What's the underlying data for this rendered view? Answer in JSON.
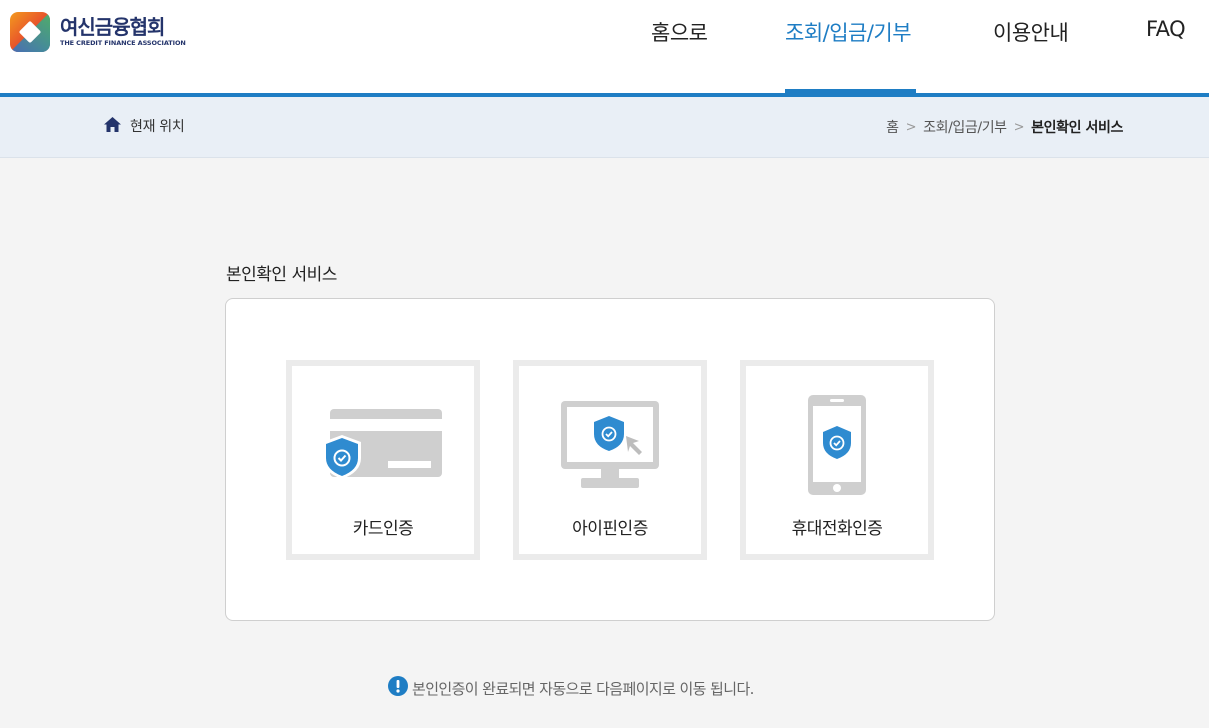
{
  "logo": {
    "name_ko": "여신금융협회",
    "name_en": "THE CREDIT FINANCE ASSOCIATION"
  },
  "nav": {
    "items": [
      {
        "label": "홈으로"
      },
      {
        "label": "조회/입금/기부"
      },
      {
        "label": "이용안내"
      },
      {
        "label": "FAQ"
      }
    ],
    "active_index": 1
  },
  "location": {
    "label": "현재 위치",
    "breadcrumbs": [
      "홈",
      "조회/입금/기부",
      "본인확인 서비스"
    ],
    "separator": ">"
  },
  "main": {
    "title": "본인확인 서비스",
    "cards": [
      {
        "label": "카드인증",
        "icon": "card-shield-icon"
      },
      {
        "label": "아이핀인증",
        "icon": "monitor-shield-icon"
      },
      {
        "label": "휴대전화인증",
        "icon": "phone-shield-icon"
      }
    ],
    "notice": "본인인증이 완료되면 자동으로 다음페이지로 이동 됩니다."
  },
  "colors": {
    "accent": "#1e7dc4",
    "location_bg": "#e9eff6",
    "icon_gray": "#cfcfcf",
    "shield": "#2f8bd0"
  }
}
